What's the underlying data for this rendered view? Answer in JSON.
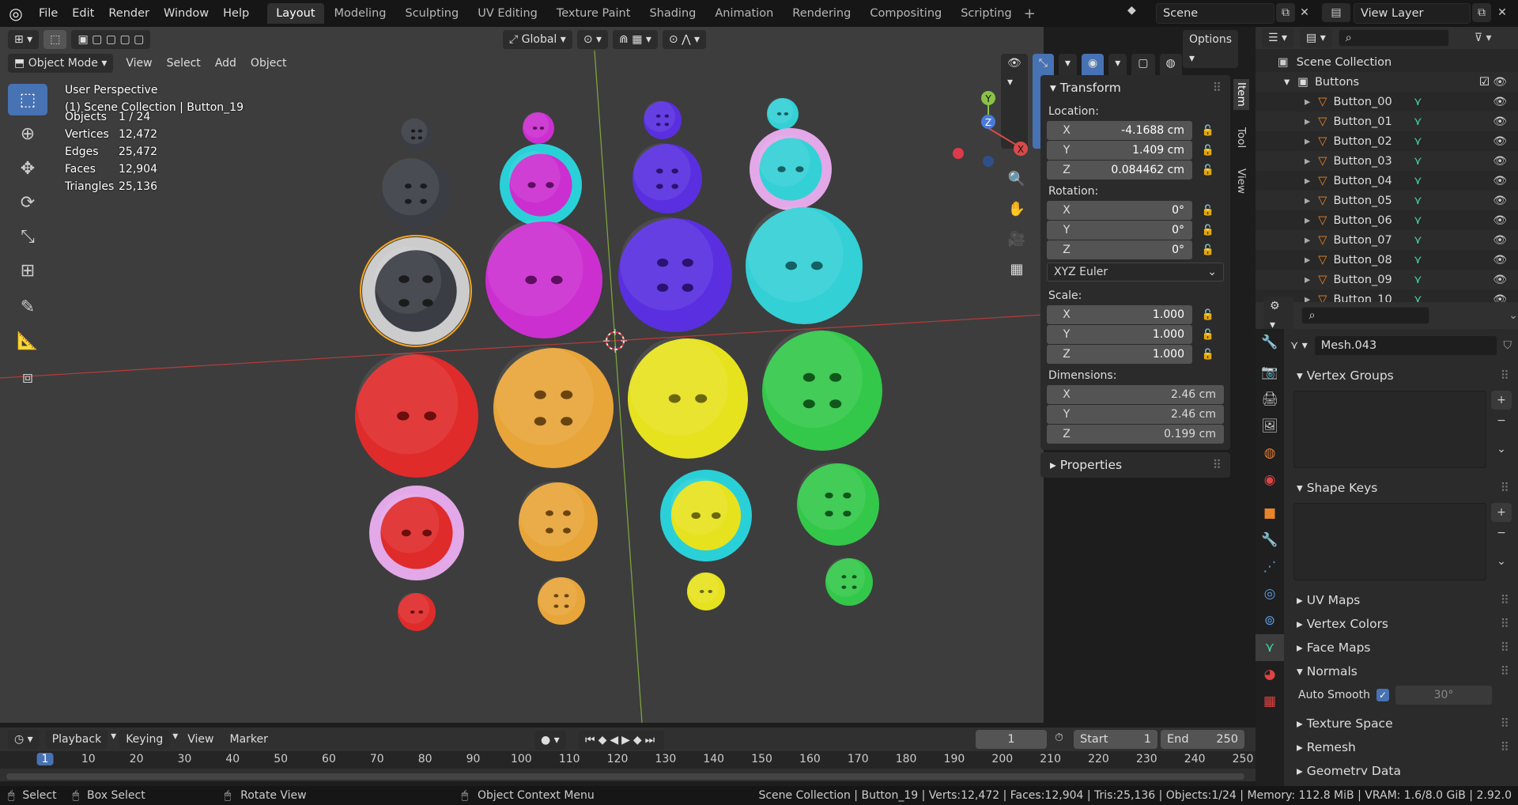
{
  "menu": [
    "File",
    "Edit",
    "Render",
    "Window",
    "Help"
  ],
  "workspaces": [
    "Layout",
    "Modeling",
    "Sculpting",
    "UV Editing",
    "Texture Paint",
    "Shading",
    "Animation",
    "Rendering",
    "Compositing",
    "Scripting"
  ],
  "active_workspace": "Layout",
  "scene": "Scene",
  "view_layer": "View Layer",
  "viewport": {
    "mode": "Object Mode",
    "menus": [
      "View",
      "Select",
      "Add",
      "Object"
    ],
    "orientation": "Global",
    "options": "Options",
    "perspective": "User Perspective",
    "collection_info": "(1) Scene Collection | Button_19",
    "stats": [
      {
        "k": "Objects",
        "v": "1 / 24"
      },
      {
        "k": "Vertices",
        "v": "12,472"
      },
      {
        "k": "Edges",
        "v": "25,472"
      },
      {
        "k": "Faces",
        "v": "12,904"
      },
      {
        "k": "Triangles",
        "v": "25,136"
      }
    ],
    "gizmo": {
      "x": "X",
      "y": "Y",
      "z": "Z"
    }
  },
  "npanel": {
    "tabs": [
      "Item",
      "Tool",
      "View"
    ],
    "transform_title": "Transform",
    "location_label": "Location:",
    "location": {
      "x": "-4.1688 cm",
      "y": "1.409 cm",
      "z": "0.084462 cm"
    },
    "rotation_label": "Rotation:",
    "rotation": {
      "x": "0°",
      "y": "0°",
      "z": "0°"
    },
    "rotation_mode": "XYZ Euler",
    "scale_label": "Scale:",
    "scale": {
      "x": "1.000",
      "y": "1.000",
      "z": "1.000"
    },
    "dimensions_label": "Dimensions:",
    "dimensions": {
      "x": "2.46 cm",
      "y": "2.46 cm",
      "z": "0.199 cm"
    },
    "properties_title": "Properties"
  },
  "outliner": {
    "root": "Scene Collection",
    "collection": "Buttons",
    "items": [
      "Button_00",
      "Button_01",
      "Button_02",
      "Button_03",
      "Button_04",
      "Button_05",
      "Button_06",
      "Button_07",
      "Button_08",
      "Button_09",
      "Button_10"
    ]
  },
  "properties": {
    "mesh_name": "Mesh.043",
    "sections": {
      "vertex_groups": "Vertex Groups",
      "shape_keys": "Shape Keys",
      "uv_maps": "UV Maps",
      "vertex_colors": "Vertex Colors",
      "face_maps": "Face Maps",
      "normals": "Normals",
      "auto_smooth": "Auto Smooth",
      "angle": "30°",
      "texture_space": "Texture Space",
      "remesh": "Remesh",
      "geometry_data": "Geometry Data"
    }
  },
  "timeline": {
    "menus": [
      "Playback",
      "Keying",
      "View",
      "Marker"
    ],
    "current_frame": "1",
    "start_label": "Start",
    "start": "1",
    "end_label": "End",
    "end": "250",
    "ticks": [
      "1",
      "10",
      "20",
      "30",
      "40",
      "50",
      "60",
      "70",
      "80",
      "90",
      "100",
      "110",
      "120",
      "130",
      "140",
      "150",
      "160",
      "170",
      "180",
      "190",
      "200",
      "210",
      "220",
      "230",
      "240",
      "250"
    ]
  },
  "statusbar": {
    "select": "Select",
    "box_select": "Box Select",
    "rotate_view": "Rotate View",
    "context_menu": "Object Context Menu",
    "info": "Scene Collection | Button_19 | Verts:12,472 | Faces:12,904 | Tris:25,136 | Objects:1/24 | Memory: 112.8 MiB | VRAM: 1.6/8.0 GiB | 2.92.0"
  },
  "colors": {
    "accent": "#4772b3",
    "selected": "#f5a623",
    "x_axis": "#d94a4a",
    "y_axis": "#8ac246",
    "z_axis": "#4a7ad9"
  },
  "buttons_scene": [
    {
      "color": "#3a3d44",
      "hole": "#1b1b1b",
      "holes": 4
    },
    {
      "color": "#cc2fd0",
      "hole": "#5d0e60",
      "holes": 2
    },
    {
      "color": "#5a2fe0",
      "hole": "#2a1370",
      "holes": 4
    },
    {
      "color": "#33d0d6",
      "hole": "#146064",
      "holes": 2
    },
    {
      "color": "#e02b2b",
      "hole": "#6a0e0e",
      "holes": 2
    },
    {
      "color": "#e8a53a",
      "hole": "#6a4410",
      "holes": 4
    },
    {
      "color": "#e6e21e",
      "hole": "#6a6610",
      "holes": 2
    },
    {
      "color": "#34c84a",
      "hole": "#10561a",
      "holes": 4
    }
  ]
}
